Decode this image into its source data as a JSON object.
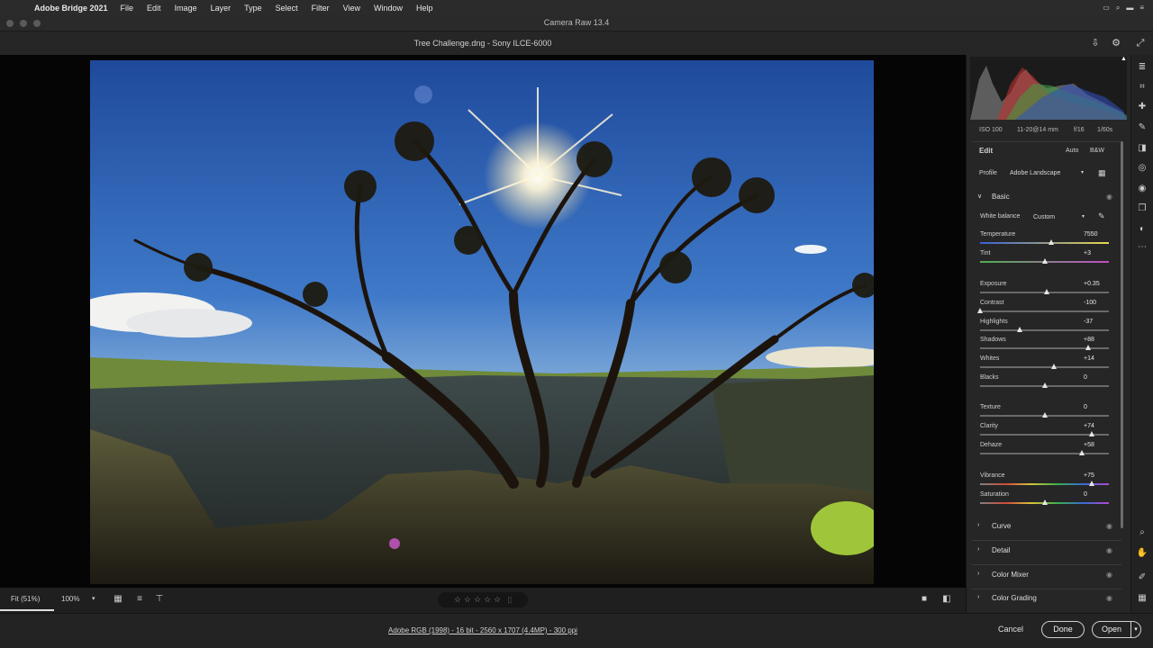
{
  "menubar": {
    "apple": "",
    "app_name": "Adobe Bridge 2021",
    "items": [
      "File",
      "Edit",
      "Image",
      "Layer",
      "Type",
      "Select",
      "Filter",
      "View",
      "Window",
      "Help"
    ]
  },
  "window": {
    "title": "Camera Raw 13.4"
  },
  "document": {
    "title": "Tree Challenge.dng  -  Sony ILCE-6000"
  },
  "histogram": {
    "iso": "ISO 100",
    "lens": "11-20@14 mm",
    "aperture": "f/16",
    "shutter": "1/60s"
  },
  "edit": {
    "title": "Edit",
    "auto_label": "Auto",
    "bw_label": "B&W",
    "profile_label": "Profile",
    "profile_value": "Adobe Landscape"
  },
  "basic": {
    "title": "Basic",
    "white_balance_label": "White balance",
    "white_balance_value": "Custom",
    "sliders": [
      {
        "label": "Temperature",
        "value": "7550",
        "pos": 0.55
      },
      {
        "label": "Tint",
        "value": "+3",
        "pos": 0.5
      },
      {
        "label": "Exposure",
        "value": "+0.35",
        "pos": 0.52
      },
      {
        "label": "Contrast",
        "value": "-100",
        "pos": 0.0
      },
      {
        "label": "Highlights",
        "value": "-37",
        "pos": 0.31
      },
      {
        "label": "Shadows",
        "value": "+88",
        "pos": 0.84
      },
      {
        "label": "Whites",
        "value": "+14",
        "pos": 0.57
      },
      {
        "label": "Blacks",
        "value": "0",
        "pos": 0.5
      },
      {
        "label": "Texture",
        "value": "0",
        "pos": 0.5
      },
      {
        "label": "Clarity",
        "value": "+74",
        "pos": 0.87
      },
      {
        "label": "Dehaze",
        "value": "+58",
        "pos": 0.79
      },
      {
        "label": "Vibrance",
        "value": "+75",
        "pos": 0.87
      },
      {
        "label": "Saturation",
        "value": "0",
        "pos": 0.5
      }
    ]
  },
  "sections": [
    "Curve",
    "Detail",
    "Color Mixer",
    "Color Grading"
  ],
  "bottombar": {
    "fit": "Fit (51%)",
    "zoom": "100%",
    "stars": [
      "☆",
      "☆",
      "☆",
      "☆",
      "☆"
    ]
  },
  "footer": {
    "info": "Adobe RGB (1998) - 16 bit - 2560 x 1707 (4.4MP) - 300 ppi",
    "cancel": "Cancel",
    "done": "Done",
    "open": "Open"
  },
  "colors": {
    "panel_bg": "#262626",
    "canvas_bg": "#050505",
    "temperature_gradient": [
      "#3a5fd6",
      "#e8d64a"
    ],
    "tint_gradient": [
      "#4fb04f",
      "#c04ec4"
    ]
  },
  "icons": {
    "tray": [
      "control-icon",
      "search-icon",
      "battery-icon",
      "menu-icon"
    ],
    "doc": [
      "save-icon",
      "gear-icon",
      "fullscreen-icon"
    ],
    "tools": [
      "edit-icon",
      "crop-icon",
      "heal-icon",
      "brush-icon",
      "gradient-icon",
      "radial-icon",
      "redeye-icon",
      "snapshots-icon",
      "presets-icon",
      "more-icon",
      "zoom-icon",
      "hand-icon",
      "sampler-icon",
      "grid-icon"
    ]
  }
}
